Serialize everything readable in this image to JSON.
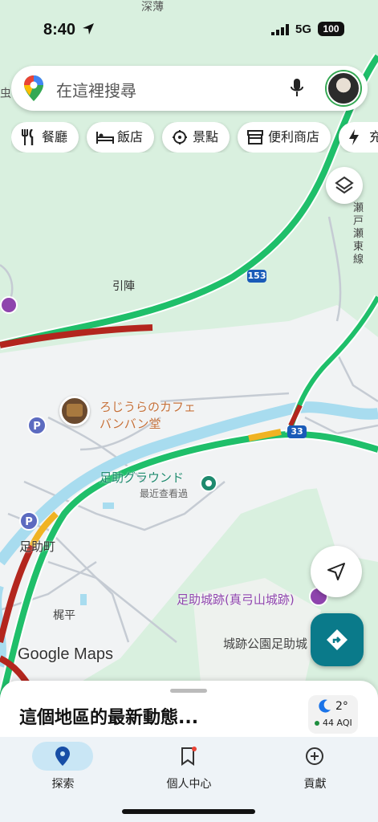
{
  "status_bar": {
    "time": "8:40",
    "network": "5G",
    "battery": "100"
  },
  "search": {
    "placeholder": "在這裡搜尋"
  },
  "chips": [
    {
      "label": "餐廳",
      "icon": "restaurant-icon"
    },
    {
      "label": "飯店",
      "icon": "hotel-icon"
    },
    {
      "label": "景點",
      "icon": "attraction-icon"
    },
    {
      "label": "便利商店",
      "icon": "convenience-store-icon"
    },
    {
      "label": "充",
      "icon": "charging-icon"
    }
  ],
  "map_labels": {
    "top_place": "深薄",
    "left_edge": "虫",
    "village": "引陣",
    "railway": "瀬戸瀬東線",
    "route_153": "153",
    "route_33": "33",
    "cafe_line1": "ろじうらのカフェ",
    "cafe_line2": "バンバン堂",
    "ground": "足助グラウンド",
    "recently_viewed": "最近查看過",
    "town": "足助町",
    "kajihira": "梶平",
    "castle": "足助城跡(真弓山城跡)",
    "park": "城跡公園足助城",
    "parking_1": "P",
    "parking_2": "P"
  },
  "map_brand": "Google Maps",
  "sheet": {
    "title": "這個地區的最新動態..."
  },
  "weather": {
    "temp": "2°",
    "aqi": "44 AQI"
  },
  "bottom_nav": [
    {
      "label": "探索",
      "icon": "explore-pin-icon",
      "active": true
    },
    {
      "label": "個人中心",
      "icon": "saved-bookmark-icon",
      "active": false
    },
    {
      "label": "貢獻",
      "icon": "contribute-plus-icon",
      "active": false
    }
  ],
  "colors": {
    "map_green": "#d9f0df",
    "road_traffic_green": "#1fbf6a",
    "river": "#a8dcef",
    "accent_teal": "#0a7a8a"
  }
}
